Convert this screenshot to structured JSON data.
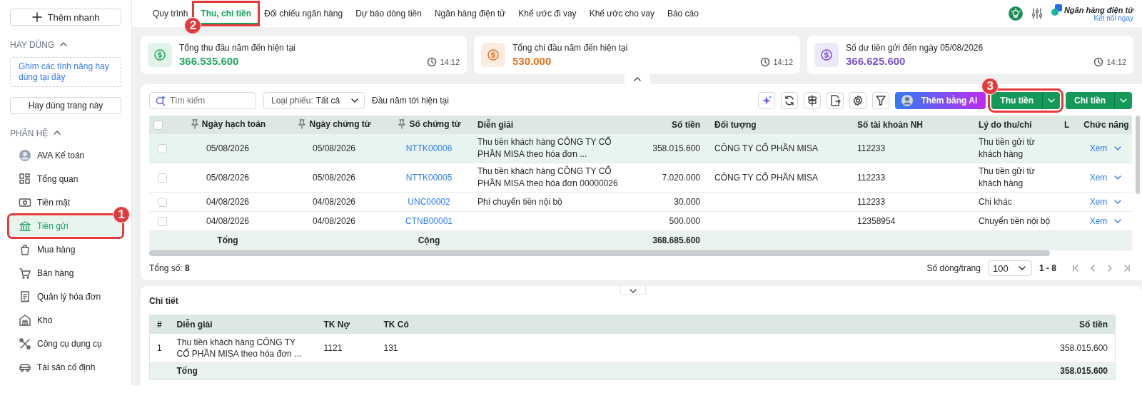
{
  "sidebar": {
    "quick_add": "Thêm nhanh",
    "favorites": {
      "title": "HAY DÙNG",
      "expanded": true,
      "hint": "Ghim các tính năng hay dùng tại đây",
      "button": "Hay dùng trang này"
    },
    "modules": {
      "title": "PHÂN HỆ",
      "expanded": true,
      "items": [
        {
          "label": "AVA Kế toán",
          "selected": false
        },
        {
          "label": "Tổng quan",
          "selected": false
        },
        {
          "label": "Tiền mặt",
          "selected": false
        },
        {
          "label": "Tiền gửi",
          "selected": true,
          "callout": "1"
        },
        {
          "label": "Mua hàng",
          "selected": false
        },
        {
          "label": "Bán hàng",
          "selected": false
        },
        {
          "label": "Quản lý hóa đơn",
          "selected": false
        },
        {
          "label": "Kho",
          "selected": false
        },
        {
          "label": "Công cụ dụng cụ",
          "selected": false
        },
        {
          "label": "Tài sản cố định",
          "selected": false
        }
      ]
    }
  },
  "tabs": [
    {
      "label": "Quy trình",
      "selected": false
    },
    {
      "label": "Thu, chi tiền",
      "selected": true,
      "callout": "2"
    },
    {
      "label": "Đối chiếu ngân hàng",
      "selected": false
    },
    {
      "label": "Dự báo dòng tiền",
      "selected": false
    },
    {
      "label": "Ngân hàng điện tử",
      "selected": false
    },
    {
      "label": "Khế ước đi vay",
      "selected": false
    },
    {
      "label": "Khế ước cho vay",
      "selected": false
    },
    {
      "label": "Báo cáo",
      "selected": false
    }
  ],
  "header_right": {
    "bank_title": "Ngân hàng điện tử",
    "bank_link": "Kết nối ngay"
  },
  "summary_cards": [
    {
      "label": "Tổng thu đầu năm đến hiện tại",
      "value": "366.535.600",
      "time": "14:12",
      "color": "#22a65a"
    },
    {
      "label": "Tổng chi đầu năm đến hiện tại",
      "value": "530.000",
      "time": "14:12",
      "color": "#e8731a"
    },
    {
      "label": "Số dư tiền gửi đến ngày 05/08/2026",
      "value": "366.625.600",
      "time": "14:12",
      "color": "#7b4fd6"
    }
  ],
  "toolbar": {
    "search_placeholder": "Tìm kiếm",
    "type_label": "Loại phiếu:",
    "type_value": "Tất cả",
    "period": "Đầu năm tới hiện tại",
    "ai_button": "Thêm bằng AI",
    "receive_button": {
      "label": "Thu tiền",
      "callout": "3"
    },
    "pay_button": {
      "label": "Chi tiền"
    }
  },
  "table": {
    "columns": [
      {
        "label": "Ngày hạch toán",
        "pinned": true,
        "kind": "date"
      },
      {
        "label": "Ngày chứng từ",
        "pinned": true,
        "kind": "date"
      },
      {
        "label": "Số chứng từ",
        "pinned": true,
        "kind": "link"
      },
      {
        "label": "Diễn giải",
        "pinned": false,
        "kind": "text"
      },
      {
        "label": "Số tiền",
        "pinned": false,
        "kind": "amount"
      },
      {
        "label": "Đối tượng",
        "pinned": false,
        "kind": "text"
      },
      {
        "label": "Số tài khoản NH",
        "pinned": false,
        "kind": "text"
      },
      {
        "label": "Lý do thu/chi",
        "pinned": false,
        "kind": "reason"
      },
      {
        "label": "L",
        "pinned": false,
        "kind": "cut"
      },
      {
        "label": "Chức năng",
        "pinned": false,
        "kind": "action"
      }
    ],
    "rows": [
      {
        "checked": false,
        "hovered": true,
        "cells": [
          "05/08/2026",
          "05/08/2026",
          "NTTK00006",
          "Thu tiền khách hàng CÔNG TY CỔ PHẦN MISA theo hóa đơn ...",
          "358.015.600",
          "CÔNG TY CỔ PHẦN MISA",
          "112233",
          "Thu tiền gửi từ khách hàng",
          "",
          "Xem"
        ]
      },
      {
        "checked": false,
        "hovered": false,
        "cells": [
          "05/08/2026",
          "05/08/2026",
          "NTTK00005",
          "Thu tiền khách hàng CÔNG TY CỔ PHẦN MISA theo hóa đơn 00000026",
          "7.020.000",
          "CÔNG TY CỔ PHẦN MISA",
          "112233",
          "Thu tiền gửi từ khách hàng",
          "",
          "Xem"
        ]
      },
      {
        "checked": false,
        "hovered": false,
        "cells": [
          "04/08/2026",
          "04/08/2026",
          "UNC00002",
          "Phí chuyển tiền nội bộ",
          "30.000",
          "",
          "112233",
          "Chi khác",
          "",
          "Xem"
        ]
      },
      {
        "checked": false,
        "hovered": false,
        "cells": [
          "04/08/2026",
          "04/08/2026",
          "CTNB00001",
          "",
          "500.000",
          "",
          "12358954",
          "Chuyển tiền nội bộ",
          "",
          "Xem"
        ]
      }
    ],
    "all_checked": false,
    "footer": {
      "label": "Tổng",
      "label_2": "Cộng",
      "amount": "368.685.600"
    }
  },
  "summary_toggle": {
    "expanded": true
  },
  "detail_toggle": {
    "expanded": true
  },
  "pager": {
    "total": "Tổng số: **8**",
    "page_size_label": "Số dòng/trang",
    "page_size": "100",
    "range": "1 - 8"
  },
  "detail": {
    "title": "Chi tiết",
    "columns": [
      "#",
      "Diễn giải",
      "TK Nợ",
      "TK Có",
      "Số tiền"
    ],
    "rows": [
      [
        "1",
        "Thu tiền khách hàng CÔNG TY CỔ PHẦN MISA theo hóa đơn ...",
        "1121",
        "131",
        "358.015.600"
      ]
    ],
    "total_label": "Tổng",
    "total": "358.015.600"
  }
}
